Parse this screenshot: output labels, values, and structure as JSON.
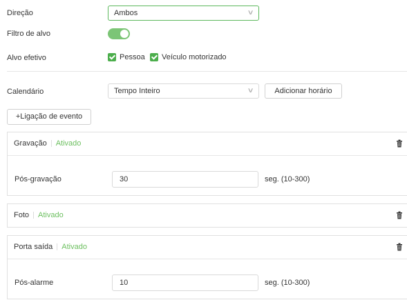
{
  "direction": {
    "label": "Direção",
    "value": "Ambos"
  },
  "target_filter": {
    "label": "Filtro de alvo",
    "enabled": true
  },
  "effective_target": {
    "label": "Alvo efetivo",
    "options": [
      {
        "label": "Pessoa",
        "checked": true
      },
      {
        "label": "Veículo motorizado",
        "checked": true
      }
    ]
  },
  "calendar": {
    "label": "Calendário",
    "value": "Tempo Inteiro",
    "add_button": "Adicionar horário"
  },
  "event_link_button": "+Ligação de evento",
  "panels": {
    "recording": {
      "title": "Gravação",
      "status": "Ativado",
      "field_label": "Pós-gravação",
      "field_value": "30",
      "unit": "seg. (10-300)"
    },
    "photo": {
      "title": "Foto",
      "status": "Ativado"
    },
    "output": {
      "title": "Porta saída",
      "status": "Ativado",
      "field_label": "Pós-alarme",
      "field_value": "10",
      "unit": "seg. (10-300)"
    }
  },
  "colors": {
    "accent": "#5cb85c",
    "status_text": "#6cbf5f",
    "checkbox": "#4cae4c"
  },
  "icons": {
    "select_arrow": "chevron-down-icon",
    "delete": "trash-icon",
    "checkbox": "check-icon"
  }
}
